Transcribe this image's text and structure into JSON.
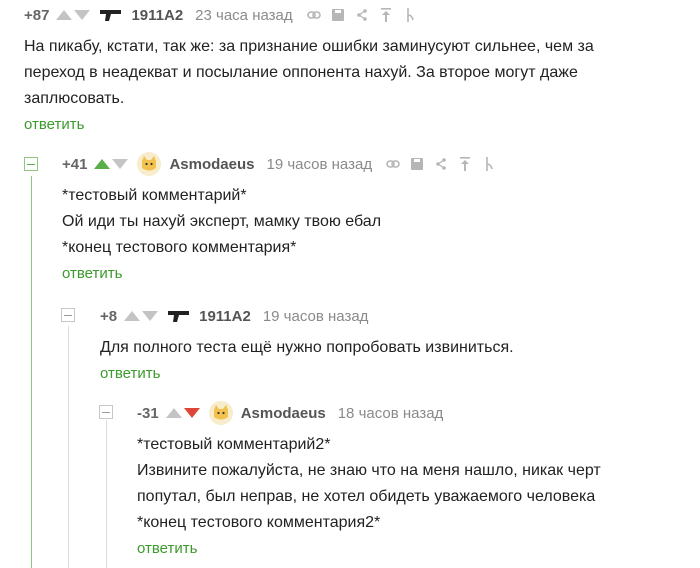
{
  "comments": [
    {
      "rating": "+87",
      "author": "1911A2",
      "time": "23 часа назад",
      "vote_state": "none",
      "avatar": "pistol-icon",
      "text": [
        "На пикабу, кстати, так же: за признание ошибки заминусуют сильнее, чем за",
        "переход в неадекват и посылание оппонента нахуй. За второе могут даже",
        "заплюсовать."
      ],
      "reply": "ответить"
    },
    {
      "rating": "+41",
      "author": "Asmodaeus",
      "time": "19 часов назад",
      "vote_state": "up",
      "avatar": "cat-avatar-icon",
      "text": [
        "*тестовый комментарий*",
        "Ой иди ты нахуй эксперт, мамку твою ебал",
        "*конец тестового комментария*"
      ],
      "reply": "ответить"
    },
    {
      "rating": "+8",
      "author": "1911A2",
      "time": "19 часов назад",
      "vote_state": "none",
      "avatar": "pistol-icon",
      "text": [
        "Для полного теста ещё нужно попробовать извиниться."
      ],
      "reply": "ответить"
    },
    {
      "rating": "-31",
      "author": "Asmodaeus",
      "time": "18 часов назад",
      "vote_state": "down",
      "avatar": "cat-avatar-icon",
      "text": [
        "*тестовый комментарий2*",
        "Извините пожалуйста, не знаю что на меня нашло, никак черт",
        "попутал, был неправ, не хотел обидеть уважаемого человека",
        "*конец тестового комментария2*"
      ],
      "reply": "ответить"
    }
  ],
  "colors": {
    "accent_green": "#3b9a2c",
    "upvote_active": "#5aae48",
    "downvote_active": "#e0453a",
    "inactive_icon": "#c4c4c4"
  }
}
